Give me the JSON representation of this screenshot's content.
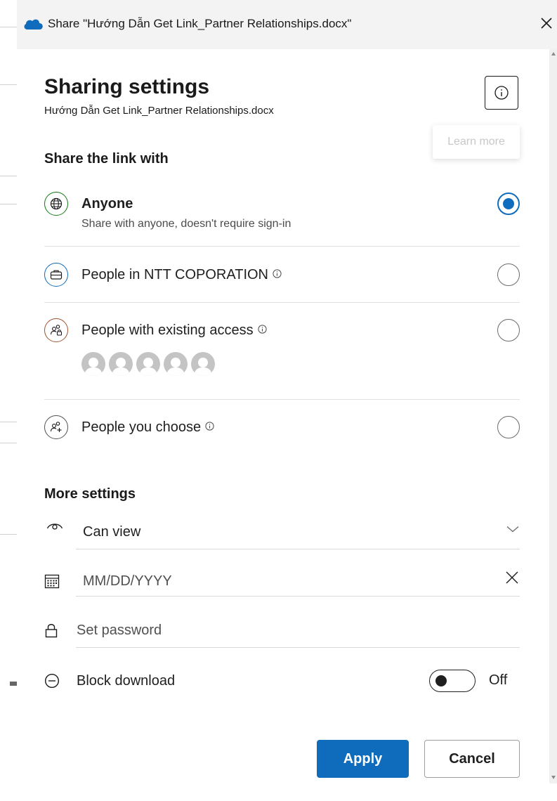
{
  "window": {
    "title": "Share \"Hướng Dẫn Get Link_Partner Relationships.docx\"",
    "app_icon": "onedrive-cloud-icon",
    "close_icon": "close-icon"
  },
  "header": {
    "title": "Sharing settings",
    "file_name": "Hướng Dẫn Get Link_Partner Relationships.docx",
    "info_icon": "info-icon",
    "tooltip": "Learn more"
  },
  "share_link": {
    "label": "Share the link with",
    "options": [
      {
        "title": "Anyone",
        "subtitle": "Share with anyone, doesn't require sign-in",
        "icon": "globe-icon",
        "selected": true,
        "color": "#107c10"
      },
      {
        "title": "People in NTT COPORATION",
        "icon": "briefcase-icon",
        "selected": false,
        "has_info": true,
        "color": "#0f6cbd"
      },
      {
        "title": "People with existing access",
        "icon": "people-lock-icon",
        "selected": false,
        "has_info": true,
        "color": "#a0522d"
      },
      {
        "title": "People you choose",
        "icon": "people-add-icon",
        "selected": false,
        "has_info": true,
        "color": "#505050"
      }
    ],
    "avatar_count": 5
  },
  "more_settings": {
    "label": "More settings",
    "permission": {
      "icon": "eye-icon",
      "value": "Can view",
      "dropdown_icon": "chevron-down-icon"
    },
    "expiration": {
      "icon": "calendar-icon",
      "placeholder": "MM/DD/YYYY",
      "clear_icon": "close-icon"
    },
    "password": {
      "icon": "lock-icon",
      "placeholder": "Set password"
    },
    "block_download": {
      "icon": "minus-circle-icon",
      "label": "Block download",
      "state": "Off",
      "enabled": false
    }
  },
  "buttons": {
    "apply": "Apply",
    "cancel": "Cancel"
  },
  "colors": {
    "accent": "#0f6cbd",
    "globe": "#107c10",
    "org": "#0f6cbd",
    "existing": "#a0522d"
  }
}
